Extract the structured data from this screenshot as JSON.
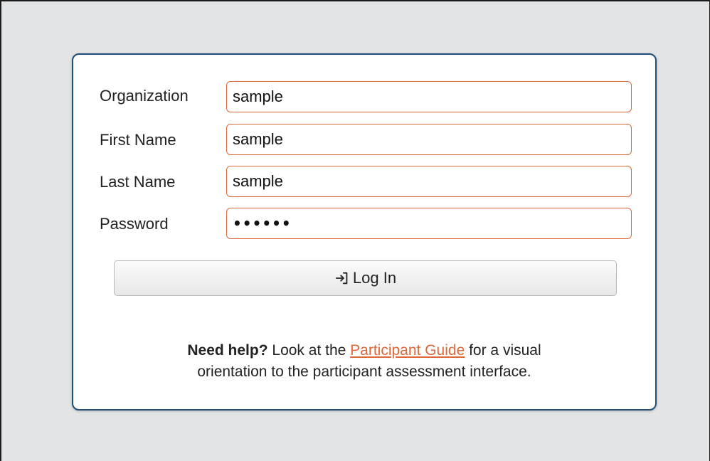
{
  "form": {
    "fields": [
      {
        "label": "Organization",
        "value": "sample"
      },
      {
        "label": "First Name",
        "value": "sample"
      },
      {
        "label": "Last Name",
        "value": "sample"
      },
      {
        "label": "Password",
        "value": "••••••"
      }
    ],
    "login_button": {
      "label": "Log In",
      "icon": "login-arrow-icon"
    }
  },
  "help": {
    "bold": "Need help?",
    "before_link": "Look at the",
    "link_text": "Participant Guide",
    "after_link_line1": "for a visual",
    "line2": "orientation to the participant assessment interface."
  },
  "colors": {
    "input_border": "#e0673a",
    "card_border": "#1f4e79",
    "background": "#e3e4e6",
    "link": "#e0673a"
  }
}
